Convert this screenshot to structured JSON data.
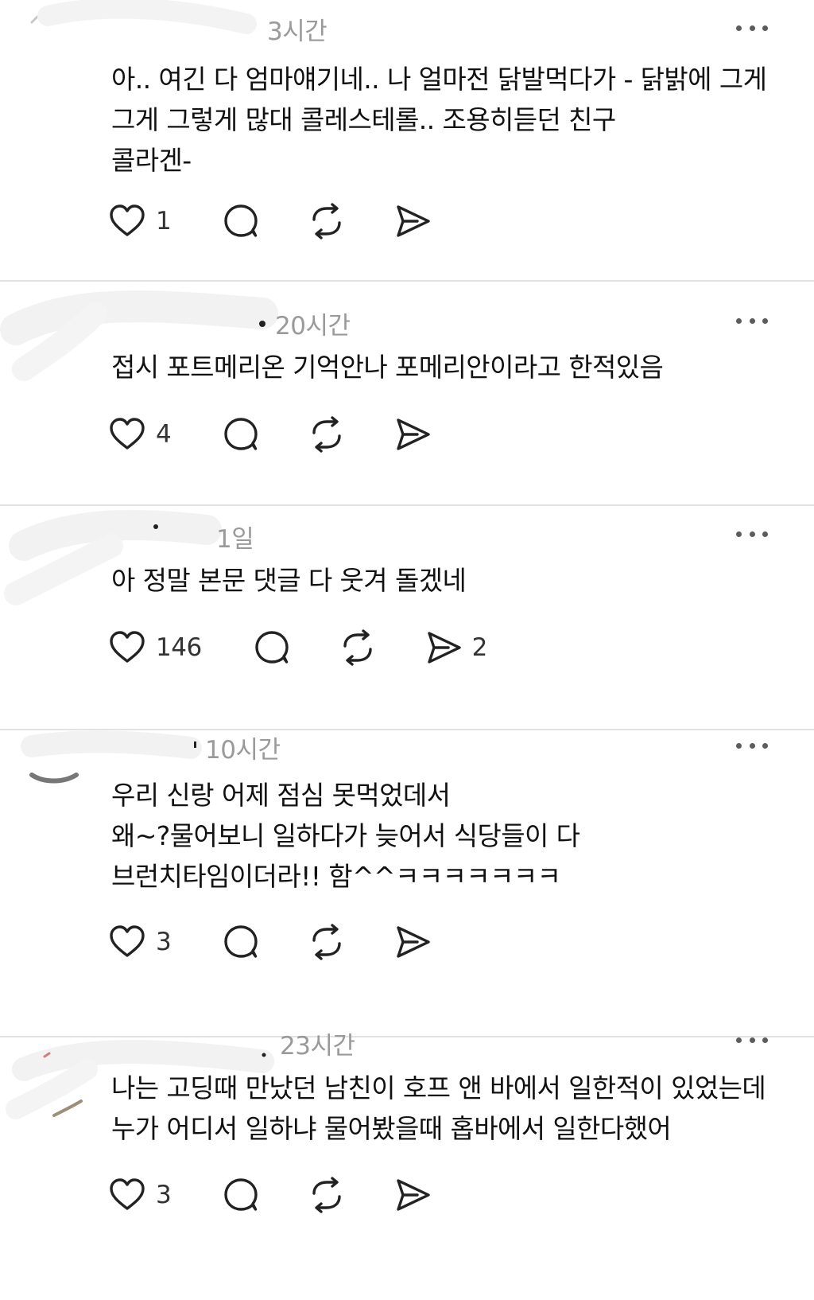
{
  "posts": [
    {
      "time": "3시간",
      "lines": [
        "아.. 여긴 다 엄마얘기네.. 나 얼마전 닭발먹다가 - 닭밝에 그게",
        "그게 그렇게 많대 콜레스테롤.. 조용히듣던 친구",
        "콜라겐-"
      ],
      "likes": "1",
      "reposts_shares": ""
    },
    {
      "time": "20시간",
      "lines": [
        "접시 포트메리온 기억안나 포메리안이라고 한적있음"
      ],
      "likes": "4",
      "reposts_shares": ""
    },
    {
      "time": "1일",
      "lines": [
        "아 정말 본문 댓글 다 웃겨 돌겠네"
      ],
      "likes": "146",
      "shares": "2"
    },
    {
      "time": "10시간",
      "lines": [
        "우리 신랑 어제 점심 못먹었데서",
        "왜~?물어보니 일하다가 늦어서 식당들이 다",
        "브런치타임이더라!! 함^^ㅋㅋㅋㅋㅋㅋㅋ"
      ],
      "likes": "3"
    },
    {
      "time": "23시간",
      "lines": [
        "나는 고딩때 만났던 남친이 호프 앤 바에서 일한적이 있었는데",
        "누가 어디서 일하냐 물어봤을때 홉바에서 일한다했어"
      ],
      "likes": "3"
    }
  ],
  "icons": {
    "like": "heart-icon",
    "reply": "comment-bubble-icon",
    "repost": "repost-icon",
    "share": "send-icon",
    "more": "more-dots-icon"
  },
  "colors": {
    "text": "#111111",
    "meta": "#9a9a9a",
    "icon": "#222222",
    "divider": "#e2e2e2"
  }
}
